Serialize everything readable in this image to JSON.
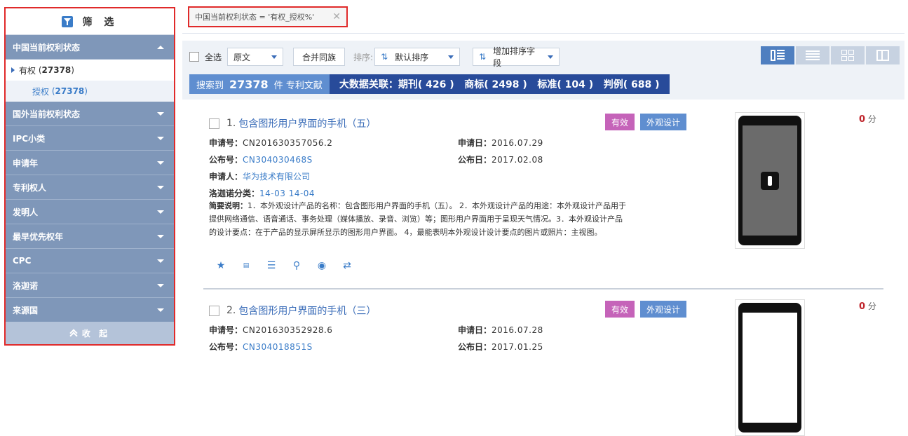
{
  "sidebar": {
    "title": "筛 选",
    "icon": "filter-icon",
    "categories": [
      {
        "label": "中国当前权利状态",
        "expanded": true
      },
      {
        "label": "国外当前权利状态"
      },
      {
        "label": "IPC小类"
      },
      {
        "label": "申请年"
      },
      {
        "label": "专利权人"
      },
      {
        "label": "发明人"
      },
      {
        "label": "最早优先权年"
      },
      {
        "label": "CPC"
      },
      {
        "label": "洛迦诺"
      },
      {
        "label": "来源国"
      }
    ],
    "status_items": [
      {
        "label": "有权",
        "count": "27378"
      },
      {
        "label": "授权",
        "count": "27378"
      }
    ],
    "collapse_label": "收 起"
  },
  "query": {
    "text": "中国当前权利状态 = '有权_授权%'",
    "close": "✕"
  },
  "toolbar": {
    "select_all": "全选",
    "doc_type": "原文",
    "merge_family": "合并同族",
    "sort_label": "排序:",
    "sort_default": "默认排序",
    "add_sort_field": "增加排序字段"
  },
  "stats": {
    "found_prefix": "搜索到",
    "found_count": "27378",
    "found_suffix": "件 专利文献",
    "bigdata": "大数据关联：期刊( 426 )   商标( 2498 )   标准( 104 )   判例( 688 )"
  },
  "results": [
    {
      "index": "1.",
      "title": "包含图形用户界面的手机（五）",
      "badge_valid": "有效",
      "badge_type": "外观设计",
      "app_no_label": "申请号：",
      "app_no": "CN201630357056.2",
      "app_date_label": "申请日：",
      "app_date": "2016.07.29",
      "pub_no_label": "公布号：",
      "pub_no": "CN304030468S",
      "pub_date_label": "公布日：",
      "pub_date": "2017.02.08",
      "applicant_label": "申请人：",
      "applicant": "华为技术有限公司",
      "locarno_label": "洛迦诺分类：",
      "locarno": "14-03 14-04",
      "abstract_label": "简要说明：",
      "abstract": "1．本外观设计产品的名称：包含图形用户界面的手机（五）。 2．本外观设计产品的用途：本外观设计产品用于提供网络通信、语音通话、事务处理（媒体播放、录音、浏览）等；图形用户界面用于呈现天气情况。3．本外观设计产品的设计要点：在于产品的显示屏所显示的图形用户界面。 4，最能表明本外观设计设计要点的图片或照片：主视图。",
      "score": "0",
      "score_unit": "分"
    },
    {
      "index": "2.",
      "title": "包含图形用户界面的手机（三）",
      "badge_valid": "有效",
      "badge_type": "外观设计",
      "app_no_label": "申请号：",
      "app_no": "CN201630352928.6",
      "app_date_label": "申请日：",
      "app_date": "2016.07.28",
      "pub_no_label": "公布号：",
      "pub_no": "CN304018851S",
      "pub_date_label": "公布日：",
      "pub_date": "2017.01.25",
      "score": "0",
      "score_unit": "分"
    }
  ],
  "colors": {
    "sidebar_header": "#7f97b9",
    "highlight_border": "#e02a2a",
    "link": "#3a7cc8",
    "badge_valid": "#c563b9",
    "badge_design": "#5f8ed0",
    "stats_dark": "#284b9a"
  }
}
